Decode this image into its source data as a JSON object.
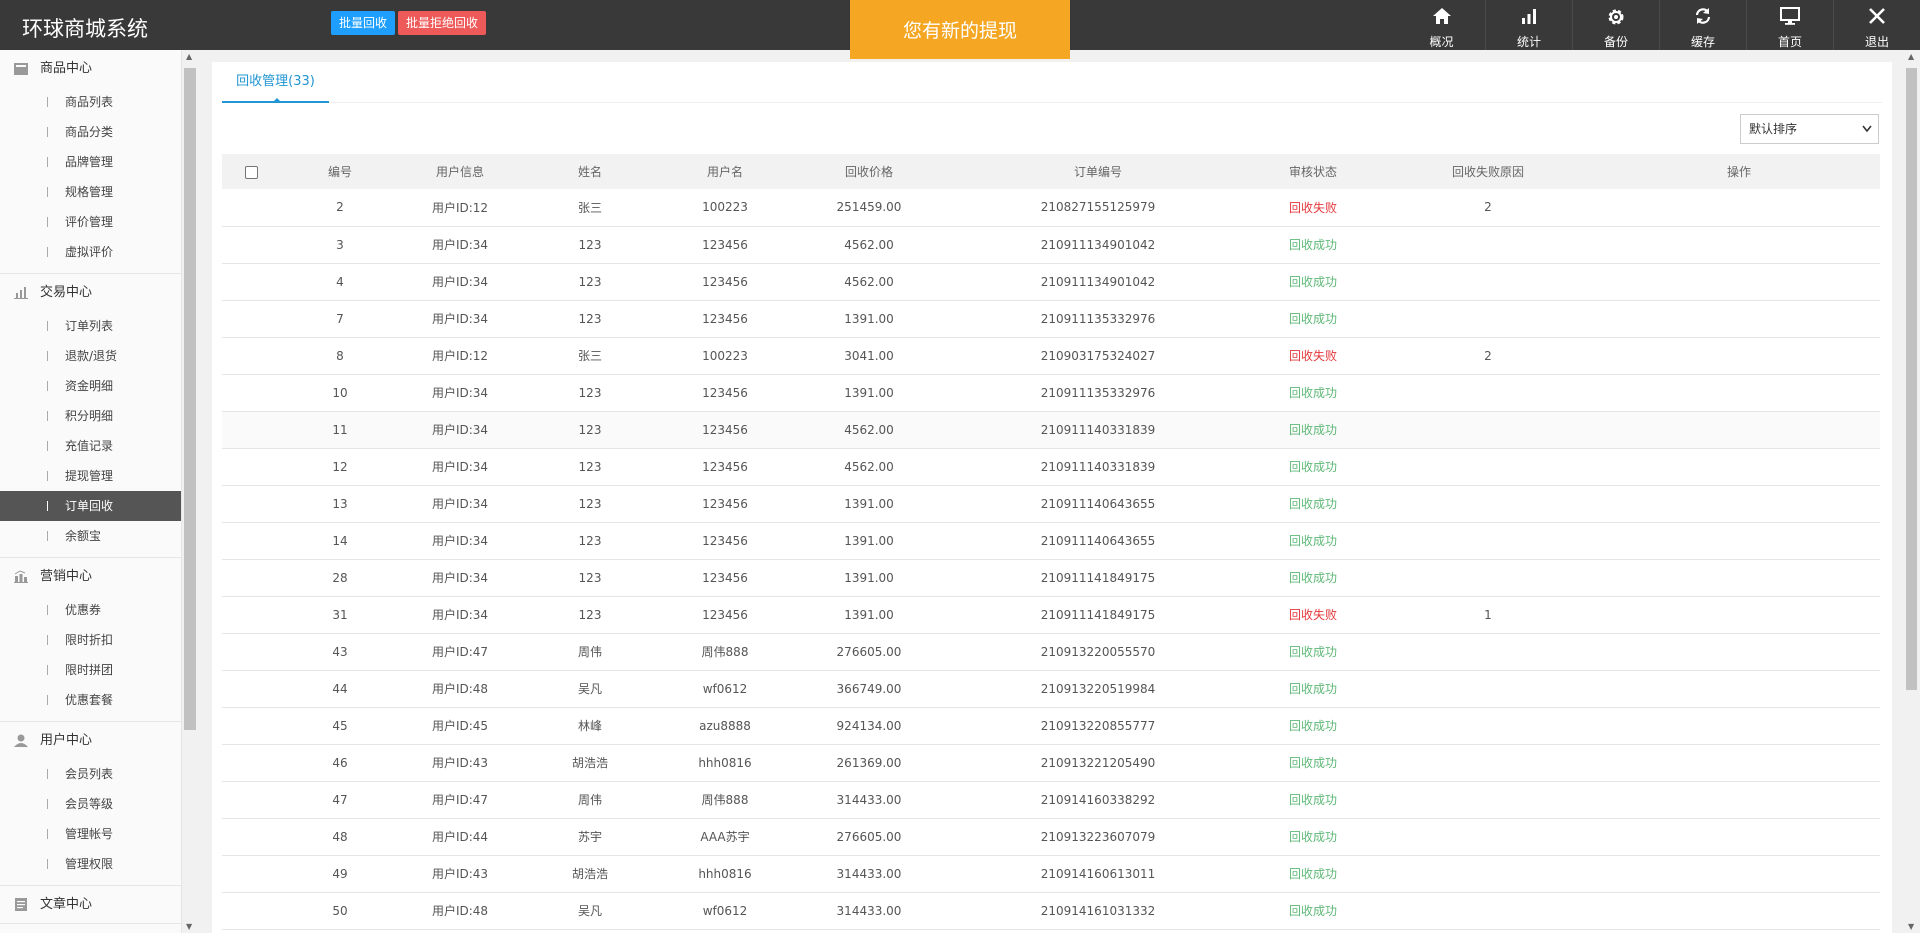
{
  "app": {
    "title": "环球商城系统",
    "notice": "您有新的提现"
  },
  "topnav": [
    {
      "label": "概况",
      "icon": "home-icon"
    },
    {
      "label": "统计",
      "icon": "bar-chart-icon"
    },
    {
      "label": "备份",
      "icon": "gear-icon"
    },
    {
      "label": "缓存",
      "icon": "refresh-icon"
    },
    {
      "label": "首页",
      "icon": "monitor-icon"
    },
    {
      "label": "退出",
      "icon": "close-icon"
    }
  ],
  "sidebar": {
    "groups": [
      {
        "title": "商品中心",
        "icon": "goods-icon",
        "items": [
          "商品列表",
          "商品分类",
          "品牌管理",
          "规格管理",
          "评价管理",
          "虚拟评价"
        ]
      },
      {
        "title": "交易中心",
        "icon": "trade-chart-icon",
        "items": [
          "订单列表",
          "退款/退货",
          "资金明细",
          "积分明细",
          "充值记录",
          "提现管理",
          "订单回收",
          "余额宝"
        ]
      },
      {
        "title": "营销中心",
        "icon": "marketing-icon",
        "items": [
          "优惠券",
          "限时折扣",
          "限时拼团",
          "优惠套餐"
        ]
      },
      {
        "title": "用户中心",
        "icon": "user-icon",
        "items": [
          "会员列表",
          "会员等级",
          "管理帐号",
          "管理权限"
        ]
      },
      {
        "title": "文章中心",
        "icon": "article-icon",
        "items": []
      }
    ],
    "active_item": "订单回收"
  },
  "main": {
    "tab_label": "回收管理(33)",
    "batch_recycle": "批量回收",
    "batch_reject": "批量拒绝回收",
    "sort_value": "默认排序",
    "columns": [
      "",
      "编号",
      "用户信息",
      "姓名",
      "用户名",
      "回收价格",
      "订单编号",
      "审核状态",
      "回收失败原因",
      "操作"
    ],
    "rows": [
      [
        "2",
        "用户ID:12",
        "张三",
        "100223",
        "251459.00",
        "210827155125979",
        "回收失败",
        "2"
      ],
      [
        "3",
        "用户ID:34",
        "123",
        "123456",
        "4562.00",
        "210911134901042",
        "回收成功",
        ""
      ],
      [
        "4",
        "用户ID:34",
        "123",
        "123456",
        "4562.00",
        "210911134901042",
        "回收成功",
        ""
      ],
      [
        "7",
        "用户ID:34",
        "123",
        "123456",
        "1391.00",
        "210911135332976",
        "回收成功",
        ""
      ],
      [
        "8",
        "用户ID:12",
        "张三",
        "100223",
        "3041.00",
        "210903175324027",
        "回收失败",
        "2"
      ],
      [
        "10",
        "用户ID:34",
        "123",
        "123456",
        "1391.00",
        "210911135332976",
        "回收成功",
        ""
      ],
      [
        "11",
        "用户ID:34",
        "123",
        "123456",
        "4562.00",
        "210911140331839",
        "回收成功",
        ""
      ],
      [
        "12",
        "用户ID:34",
        "123",
        "123456",
        "4562.00",
        "210911140331839",
        "回收成功",
        ""
      ],
      [
        "13",
        "用户ID:34",
        "123",
        "123456",
        "1391.00",
        "210911140643655",
        "回收成功",
        ""
      ],
      [
        "14",
        "用户ID:34",
        "123",
        "123456",
        "1391.00",
        "210911140643655",
        "回收成功",
        ""
      ],
      [
        "28",
        "用户ID:34",
        "123",
        "123456",
        "1391.00",
        "210911141849175",
        "回收成功",
        ""
      ],
      [
        "31",
        "用户ID:34",
        "123",
        "123456",
        "1391.00",
        "210911141849175",
        "回收失败",
        "1"
      ],
      [
        "43",
        "用户ID:47",
        "周伟",
        "周伟888",
        "276605.00",
        "210913220055570",
        "回收成功",
        ""
      ],
      [
        "44",
        "用户ID:48",
        "吴凡",
        "wf0612",
        "366749.00",
        "210913220519984",
        "回收成功",
        ""
      ],
      [
        "45",
        "用户ID:45",
        "林峰",
        "azu8888",
        "924134.00",
        "210913220855777",
        "回收成功",
        ""
      ],
      [
        "46",
        "用户ID:43",
        "胡浩浩",
        "hhh0816",
        "261369.00",
        "210913221205490",
        "回收成功",
        ""
      ],
      [
        "47",
        "用户ID:47",
        "周伟",
        "周伟888",
        "314433.00",
        "210914160338292",
        "回收成功",
        ""
      ],
      [
        "48",
        "用户ID:44",
        "苏宇",
        "AAA苏宇",
        "276605.00",
        "210913223607079",
        "回收成功",
        ""
      ],
      [
        "49",
        "用户ID:43",
        "胡浩浩",
        "hhh0816",
        "314433.00",
        "210914160613011",
        "回收成功",
        ""
      ],
      [
        "50",
        "用户ID:48",
        "吴凡",
        "wf0612",
        "314433.00",
        "210914161031332",
        "回收成功",
        ""
      ]
    ],
    "status_colors": {
      "回收失败": "#e4393c",
      "回收成功": "#5fb878"
    }
  }
}
